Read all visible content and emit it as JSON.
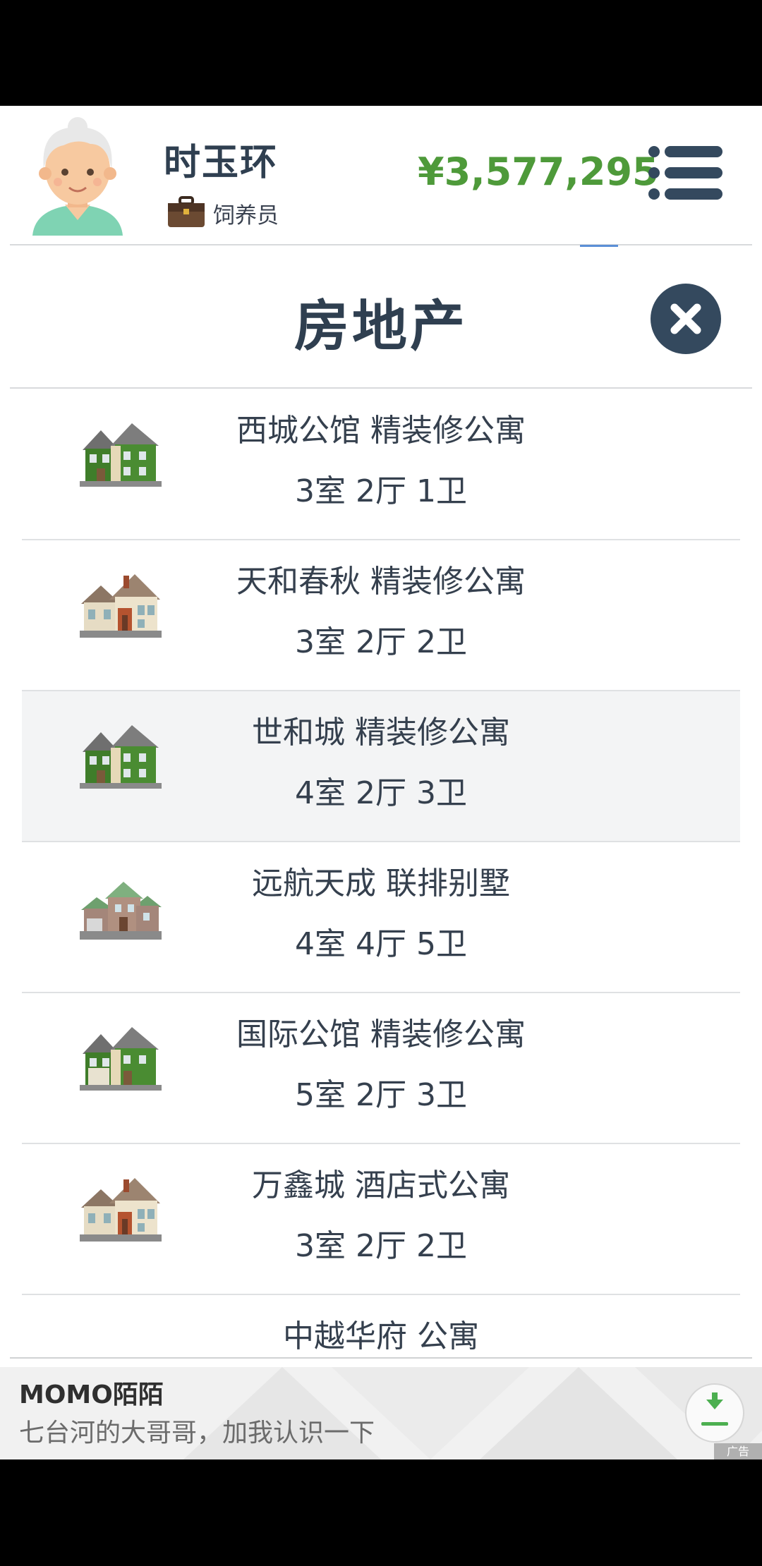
{
  "player": {
    "name": "时玉环",
    "job": "饲养员",
    "money": "¥3,577,295"
  },
  "page": {
    "title": "房地产"
  },
  "properties": [
    {
      "name": "西城公馆 精装修公寓",
      "rooms": "3室 2厅 1卫",
      "icon": "green-house-icon"
    },
    {
      "name": "天和春秋 精装修公寓",
      "rooms": "3室 2厅 2卫",
      "icon": "beige-house-icon"
    },
    {
      "name": "世和城 精装修公寓",
      "rooms": "4室 2厅 3卫",
      "icon": "green-house-icon"
    },
    {
      "name": "远航天成 联排别墅",
      "rooms": "4室 4厅 5卫",
      "icon": "townhouse-icon"
    },
    {
      "name": "国际公馆 精装修公寓",
      "rooms": "5室 2厅 3卫",
      "icon": "green-house-garage-icon"
    },
    {
      "name": "万鑫城 酒店式公寓",
      "rooms": "3室 2厅 2卫",
      "icon": "beige-house-icon"
    },
    {
      "name": "中越华府 公寓",
      "rooms": "",
      "icon": ""
    }
  ],
  "ad": {
    "title": "MOMO陌陌",
    "text": "七台河的大哥哥，加我认识一下",
    "label": "广告"
  },
  "colors": {
    "money": "#4e9a3a",
    "title": "#2f3f50",
    "close_button": "#34495e",
    "download_green": "#4caf50"
  }
}
